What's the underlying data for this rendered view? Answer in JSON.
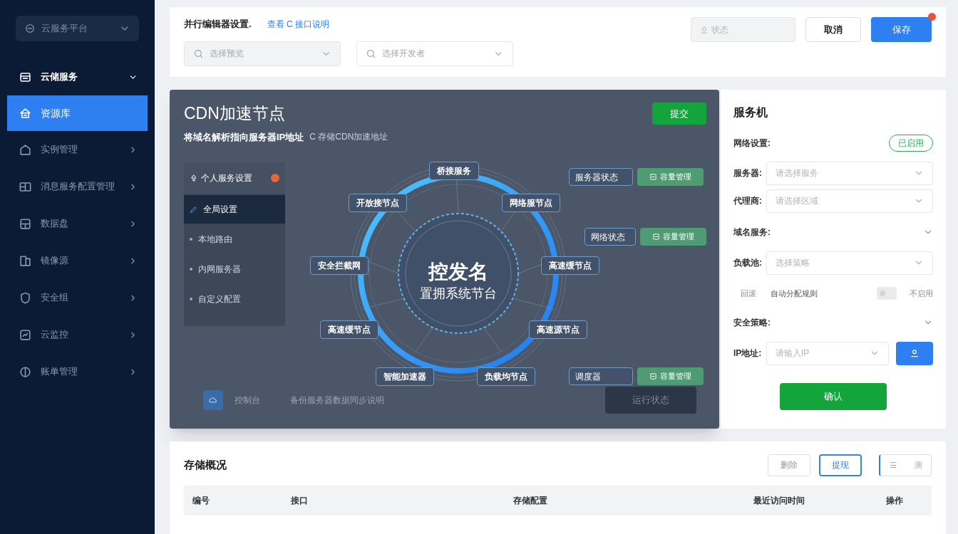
{
  "sidebar": {
    "platform_select": {
      "value": "云服务平台"
    },
    "items": [
      {
        "label": "云储服务",
        "expanded": true,
        "selected": false,
        "children": [
          {
            "label": "资源库",
            "selected": true
          }
        ]
      },
      {
        "label": "实例管理",
        "expanded": false,
        "selected": false
      },
      {
        "label": "消息服务配置管理",
        "expanded": false,
        "selected": false
      },
      {
        "label": "数据盘",
        "expanded": false,
        "selected": false
      },
      {
        "label": "镜像源",
        "expanded": false,
        "selected": false
      },
      {
        "label": "安全组",
        "expanded": false,
        "selected": false
      },
      {
        "label": "云监控",
        "expanded": false,
        "selected": false
      },
      {
        "label": "账单管理",
        "expanded": false,
        "selected": false
      }
    ]
  },
  "toolbar": {
    "title": "并行编辑器设置.",
    "link": "查看 C 接口说明",
    "filters": [
      {
        "placeholder": "选择预览",
        "disabled": true
      },
      {
        "placeholder": "选择开发者",
        "disabled": false
      }
    ],
    "status_field": {
      "placeholder": "状态"
    },
    "buttons": [
      {
        "label": "取消",
        "kind": "secondary",
        "badge": false
      },
      {
        "label": "保存",
        "kind": "primary",
        "badge": true
      }
    ]
  },
  "modal": {
    "title": "CDN加速节点",
    "submit": "提交",
    "subtitle": "将域名解析指向服务器IP地址",
    "subtitle_link": "C 存储CDN加速地址",
    "menu": {
      "header": "个人服务设置",
      "items": [
        {
          "label": "全局设置",
          "selected": true
        },
        {
          "label": "本地路由",
          "selected": false
        },
        {
          "label": "内网服务器",
          "selected": false
        },
        {
          "label": "自定义配置",
          "selected": false
        }
      ]
    },
    "hub": {
      "title": "控发名",
      "subtitle": "置拥系统节台"
    },
    "nodes": [
      "桥接服务",
      "开放接节点",
      "网络服节点",
      "安全拦截网",
      "高速缓节点",
      "高速缓节点",
      "高速源节点",
      "智能加速器",
      "负载均节点"
    ],
    "tags": [
      {
        "label": "服务器状态",
        "action": "容量管理"
      },
      {
        "label": "网络状态",
        "action": "容量管理"
      },
      {
        "label": "调度器",
        "action": "容量管理"
      }
    ],
    "footer": {
      "label": "控制台",
      "link": "备份服务器数据同步说明",
      "button": "运行状态"
    }
  },
  "server_panel": {
    "title": "服务机",
    "network": {
      "label": "网络设置:",
      "badge": "已启用"
    },
    "fields": [
      {
        "kind": "select",
        "label": "服务器:",
        "placeholder": "请选择服务"
      },
      {
        "kind": "select",
        "label": "代理商:",
        "placeholder": "请选择区域"
      },
      {
        "kind": "section",
        "label": "域名服务:"
      },
      {
        "kind": "select",
        "label": "负载池:",
        "placeholder": "选择策略"
      },
      {
        "kind": "switch",
        "label": "回滚",
        "text": "自动分配规则",
        "on": false,
        "state": "不启用"
      },
      {
        "kind": "section",
        "label": "安全策略:"
      },
      {
        "kind": "input",
        "label": "IP地址:",
        "placeholder": "请输入IP"
      }
    ],
    "confirm": "确认"
  },
  "storage": {
    "title": "存储概况",
    "buttons": [
      {
        "label": "删除",
        "selected": false
      },
      {
        "label": "提现",
        "selected": true
      }
    ],
    "view_toggle": [
      "☰",
      "测"
    ],
    "table": {
      "columns": [
        "编号",
        "接口",
        "存储配置",
        "最近访问时间",
        "操作"
      ]
    }
  }
}
